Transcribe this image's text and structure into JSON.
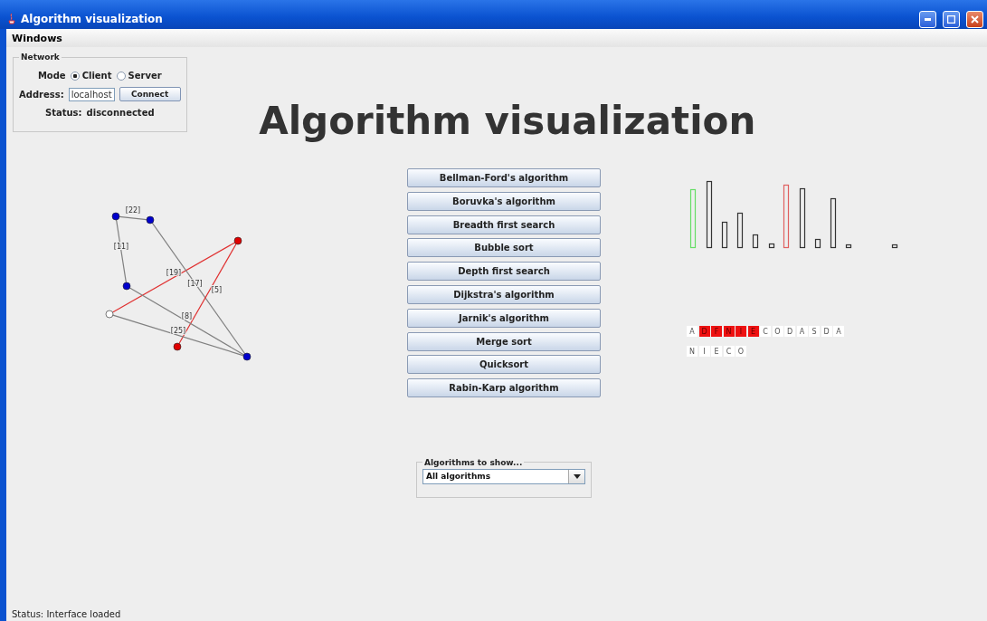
{
  "window": {
    "title": "Algorithm visualization"
  },
  "menu": [
    "Windows"
  ],
  "network": {
    "title": "Network",
    "mode_label": "Mode",
    "modes": [
      {
        "label": "Client",
        "selected": true
      },
      {
        "label": "Server",
        "selected": false
      }
    ],
    "address_label": "Address:",
    "address": "localhost",
    "connect": "Connect",
    "status_label": "Status:",
    "status": "disconnected"
  },
  "heading": "Algorithm visualization",
  "graph": {
    "nodes": [
      {
        "color": "#0000cc"
      },
      {
        "color": "#0000cc"
      },
      {
        "color": "#e00000"
      },
      {
        "color": "#0000cc"
      },
      {
        "color": "#ffffff"
      },
      {
        "color": "#e00000"
      },
      {
        "color": "#0000cc"
      }
    ],
    "edges": [
      {
        "label": "[22]",
        "color": "#808080"
      },
      {
        "label": "[11]",
        "color": "#808080"
      },
      {
        "label": "[19]",
        "color": "#e03030"
      },
      {
        "label": "[17]",
        "color": "#808080"
      },
      {
        "label": "[5]",
        "color": "#e03030"
      },
      {
        "label": "[8]",
        "color": "#808080"
      },
      {
        "label": "[25]",
        "color": "#808080"
      }
    ]
  },
  "algorithms": [
    "Bellman-Ford's algorithm",
    "Boruvka's algorithm",
    "Breadth first search",
    "Bubble sort",
    "Depth first search",
    "Dijkstra's algorithm",
    "Jarnik's algorithm",
    "Merge sort",
    "Quicksort",
    "Rabin-Karp algorithm"
  ],
  "string_rows": [
    {
      "cells": [
        {
          "char": "A",
          "highlighted": false
        },
        {
          "char": "D",
          "highlighted": true
        },
        {
          "char": "F",
          "highlighted": true
        },
        {
          "char": "N",
          "highlighted": true
        },
        {
          "char": "I",
          "highlighted": true
        },
        {
          "char": "E",
          "highlighted": true
        },
        {
          "char": "C",
          "highlighted": false
        },
        {
          "char": "O",
          "highlighted": false
        },
        {
          "char": "D",
          "highlighted": false
        },
        {
          "char": "A",
          "highlighted": false
        },
        {
          "char": "S",
          "highlighted": false
        },
        {
          "char": "D",
          "highlighted": false
        },
        {
          "char": "A",
          "highlighted": false
        }
      ]
    },
    {
      "cells": [
        {
          "char": "N",
          "highlighted": false
        },
        {
          "char": "I",
          "highlighted": false
        },
        {
          "char": "E",
          "highlighted": false
        },
        {
          "char": "C",
          "highlighted": false
        },
        {
          "char": "O",
          "highlighted": false
        }
      ]
    }
  ],
  "filter": {
    "title": "Algorithms to show...",
    "value": "All algorithms"
  },
  "status_bar": "Status: Interface loaded"
}
